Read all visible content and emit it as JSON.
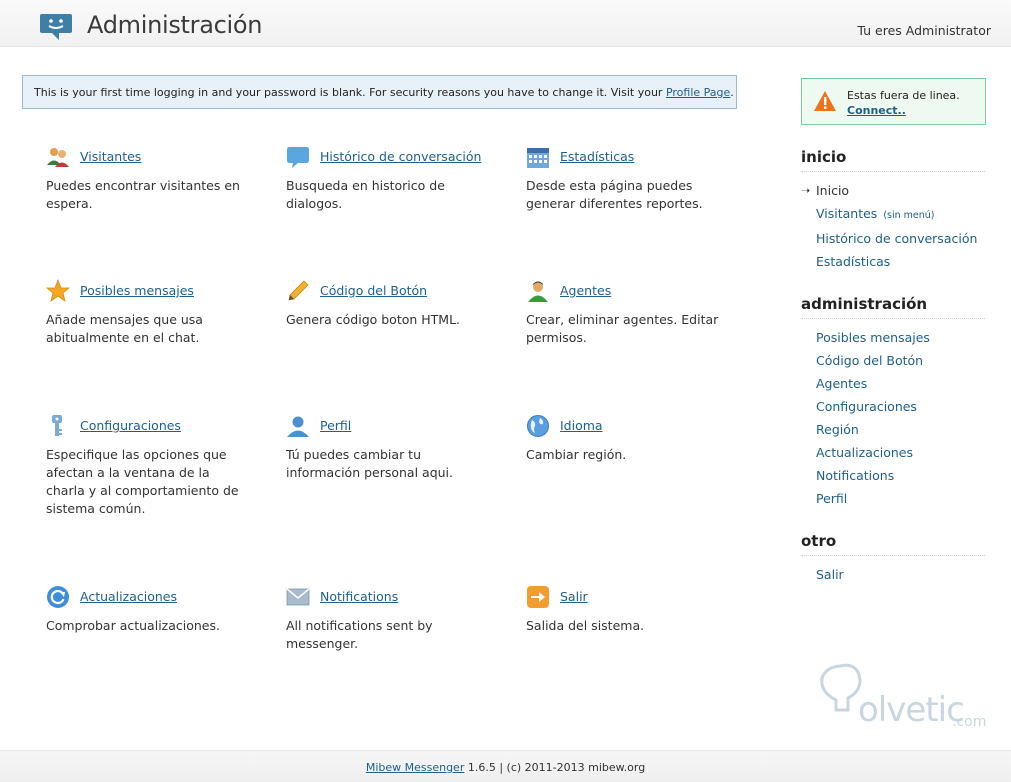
{
  "header": {
    "title": "Administración",
    "user_text": "Tu eres Administrator"
  },
  "notice": {
    "text": "This is your first time logging in and your password is blank. For security reasons you have to change it. Visit your ",
    "link": "Profile Page",
    "end": "."
  },
  "grid": {
    "items": [
      {
        "label": "Visitantes",
        "desc": "Puedes encontrar visitantes en espera.",
        "icon": "visitors-icon"
      },
      {
        "label": "Histórico de conversación",
        "desc": "Busqueda en historico de dialogos.",
        "icon": "chat-bubble-icon"
      },
      {
        "label": "Estadísticas",
        "desc": "Desde esta página puedes generar diferentes reportes.",
        "icon": "calendar-icon"
      },
      {
        "label": "Posibles mensajes",
        "desc": "Añade mensajes que usa abitualmente en el chat.",
        "icon": "star-icon"
      },
      {
        "label": "Código del Botón",
        "desc": "Genera código boton HTML.",
        "icon": "pencil-icon"
      },
      {
        "label": "Agentes",
        "desc": "Crear, eliminar agentes. Editar permisos.",
        "icon": "agent-icon"
      },
      {
        "label": "Configuraciones",
        "desc": "Especifique las opciones que afectan a la ventana de la charla y al comportamiento de sistema común.",
        "icon": "settings-key-icon"
      },
      {
        "label": "Perfil",
        "desc": "Tú puedes cambiar tu información personal aqui.",
        "icon": "user-icon"
      },
      {
        "label": "Idioma",
        "desc": "Cambiar región.",
        "icon": "globe-icon"
      },
      {
        "label": "Actualizaciones",
        "desc": "Comprobar actualizaciones.",
        "icon": "refresh-icon"
      },
      {
        "label": "Notifications",
        "desc": "All notifications sent by messenger.",
        "icon": "envelope-icon"
      },
      {
        "label": "Salir",
        "desc": "Salida del sistema.",
        "icon": "exit-arrow-icon"
      }
    ]
  },
  "sidebar": {
    "status": {
      "text": "Estas fuera de linea.",
      "link": "Connect.."
    },
    "sections": [
      {
        "heading": "inicio",
        "items": [
          "Inicio",
          "Visitantes",
          "Histórico de conversación",
          "Estadísticas"
        ],
        "extra": "(sin menú)"
      },
      {
        "heading": "administración",
        "items": [
          "Posibles mensajes",
          "Código del Botón",
          "Agentes",
          "Configuraciones",
          "Región",
          "Actualizaciones",
          "Notifications",
          "Perfil"
        ]
      },
      {
        "heading": "otro",
        "items": [
          "Salir"
        ]
      }
    ]
  },
  "footer": {
    "link": "Mibew Messenger",
    "text": " 1.6.5 | (c) 2011-2013 mibew.org"
  },
  "watermark": {
    "text": "olvetic",
    "suffix": ".com"
  },
  "colors": {
    "link": "#1f5f8b",
    "notice_bg": "#e8f1f8",
    "offline_bg": "#eef9f1"
  }
}
